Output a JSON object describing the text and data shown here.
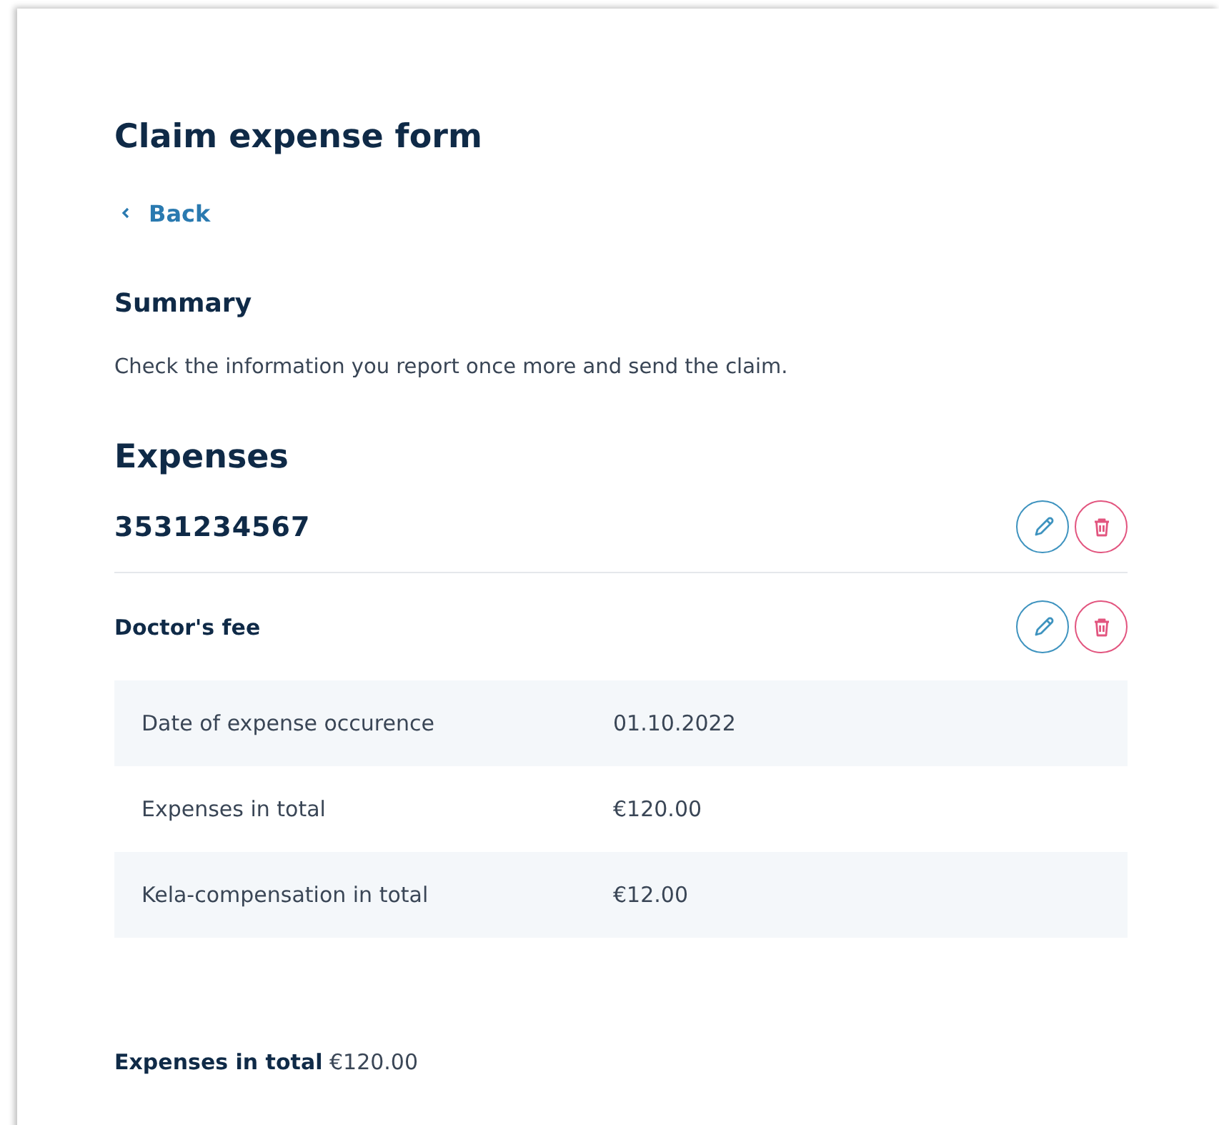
{
  "title": "Claim expense form",
  "back_link": "Back",
  "summary": {
    "heading": "Summary",
    "description": "Check the information you report once more and send the claim."
  },
  "expenses_heading": "Expenses",
  "expense_group": {
    "number": "3531234567",
    "items": [
      {
        "name": "Doctor's fee",
        "details": [
          {
            "label": "Date of expense occurence",
            "value": "01.10.2022"
          },
          {
            "label": "Expenses in total",
            "value": "€120.00"
          },
          {
            "label": "Kela-compensation in total",
            "value": "€12.00"
          }
        ]
      }
    ]
  },
  "total": "**Expenses in total** €120.00"
}
